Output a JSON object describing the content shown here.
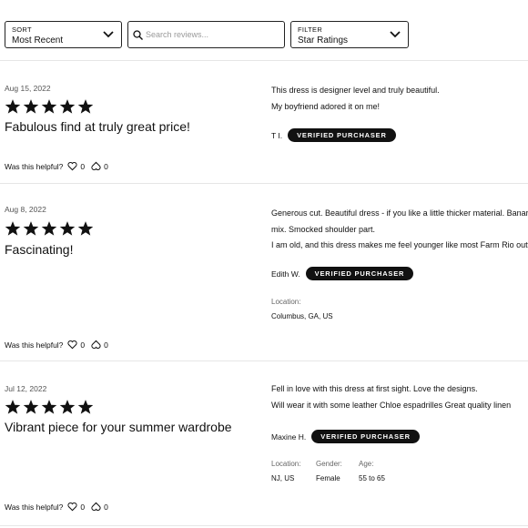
{
  "controls": {
    "sort": {
      "caption": "SORT",
      "value": "Most Recent"
    },
    "search": {
      "placeholder": "Search reviews..."
    },
    "filter": {
      "caption": "FILTER",
      "value": "Star Ratings"
    }
  },
  "reviews": [
    {
      "date": "Aug 15, 2022",
      "rating": 5,
      "title": "Fabulous find at truly great price!",
      "body": [
        "This dress is designer level and truly beautiful.",
        "My boyfriend adored it on me!"
      ],
      "author": "T I.",
      "badge": "VERIFIED PURCHASER",
      "helpful_label": "Was this helpful?",
      "yes_count": "0",
      "no_count": "0"
    },
    {
      "date": "Aug 8, 2022",
      "rating": 5,
      "title": "Fascinating!",
      "body": [
        "Generous cut. Beautiful dress - if you like a little thicker material. Banar",
        "mix. Smocked shoulder part.",
        "I am old, and this dress makes me feel younger like most Farm Rio outfi"
      ],
      "author": "Edith W.",
      "badge": "VERIFIED PURCHASER",
      "location_label": "Location:",
      "location": "Columbus, GA, US",
      "helpful_label": "Was this helpful?",
      "yes_count": "0",
      "no_count": "0"
    },
    {
      "date": "Jul 12, 2022",
      "rating": 5,
      "title": "Vibrant piece for your summer wardrobe",
      "body": [
        "Fell in love with this dress at first sight. Love the designs.",
        "Will wear it with some leather Chloe espadrilles Great quality linen"
      ],
      "author": "Maxine H.",
      "badge": "VERIFIED PURCHASER",
      "location_label": "Location:",
      "location": "NJ, US",
      "gender_label": "Gender:",
      "gender": "Female",
      "age_label": "Age:",
      "age": "55 to 65",
      "helpful_label": "Was this helpful?",
      "yes_count": "0",
      "no_count": "0"
    }
  ]
}
